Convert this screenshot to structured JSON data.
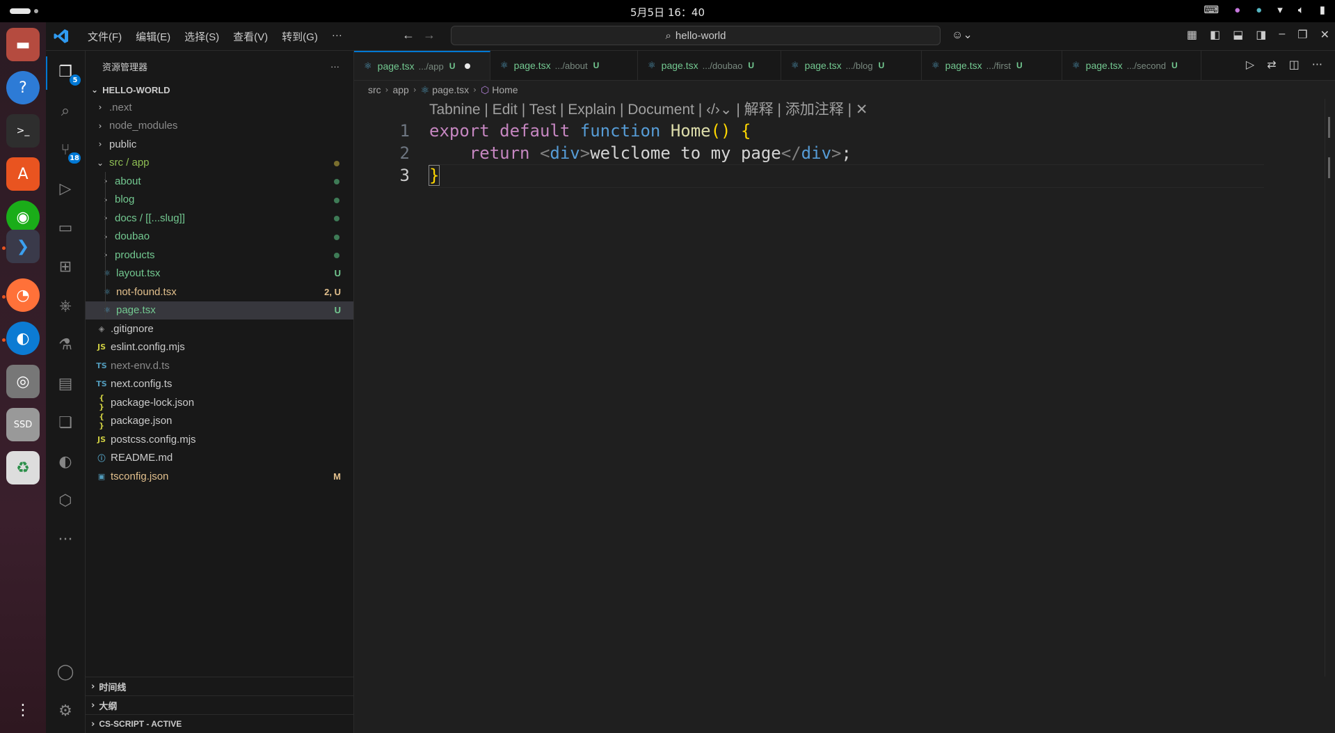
{
  "system": {
    "clock": "5月5日  16：40"
  },
  "titlebar": {
    "menu": [
      "文件(F)",
      "编辑(E)",
      "选择(S)",
      "查看(V)",
      "转到(G)",
      "···"
    ],
    "search_text": "hello-world"
  },
  "activity": {
    "explorer_badge": "5",
    "scm_badge": "18"
  },
  "sidebar": {
    "title": "资源管理器",
    "more": "···",
    "project": "HELLO-WORLD",
    "items": [
      {
        "label": ".next",
        "indent": 1,
        "kind": "folder",
        "color": "#8b8b8b"
      },
      {
        "label": "node_modules",
        "indent": 1,
        "kind": "folder",
        "color": "#8b8b8b"
      },
      {
        "label": "public",
        "indent": 1,
        "kind": "folder",
        "color": "#cccccc"
      },
      {
        "label": "src / app",
        "indent": 1,
        "kind": "folder-open",
        "color": "#8fbf54",
        "dot": "#7a6f2e"
      },
      {
        "label": "about",
        "indent": 2,
        "kind": "folder",
        "color": "#73c991",
        "dot": "#3e7b56"
      },
      {
        "label": "blog",
        "indent": 2,
        "kind": "folder",
        "color": "#73c991",
        "dot": "#3e7b56"
      },
      {
        "label": "docs / [[...slug]]",
        "indent": 2,
        "kind": "folder",
        "color": "#73c991",
        "dot": "#3e7b56"
      },
      {
        "label": "doubao",
        "indent": 2,
        "kind": "folder",
        "color": "#73c991",
        "dot": "#3e7b56"
      },
      {
        "label": "products",
        "indent": 2,
        "kind": "folder",
        "color": "#73c991",
        "dot": "#3e7b56"
      },
      {
        "label": "layout.tsx",
        "indent": 2,
        "kind": "react",
        "color": "#73c991",
        "status": "U",
        "status_color": "#73c991"
      },
      {
        "label": "not-found.tsx",
        "indent": 2,
        "kind": "react",
        "color": "#e2c08d",
        "status": "2, U",
        "status_color": "#e2c08d"
      },
      {
        "label": "page.tsx",
        "indent": 2,
        "kind": "react",
        "color": "#73c991",
        "status": "U",
        "status_color": "#73c991",
        "selected": true
      },
      {
        "label": ".gitignore",
        "indent": 1,
        "kind": "git",
        "color": "#cccccc"
      },
      {
        "label": "eslint.config.mjs",
        "indent": 1,
        "kind": "js",
        "color": "#cccccc"
      },
      {
        "label": "next-env.d.ts",
        "indent": 1,
        "kind": "ts",
        "color": "#8b8b8b"
      },
      {
        "label": "next.config.ts",
        "indent": 1,
        "kind": "ts",
        "color": "#cccccc"
      },
      {
        "label": "package-lock.json",
        "indent": 1,
        "kind": "json",
        "color": "#cccccc"
      },
      {
        "label": "package.json",
        "indent": 1,
        "kind": "json",
        "color": "#cccccc"
      },
      {
        "label": "postcss.config.mjs",
        "indent": 1,
        "kind": "js",
        "color": "#cccccc"
      },
      {
        "label": "README.md",
        "indent": 1,
        "kind": "info",
        "color": "#cccccc"
      },
      {
        "label": "tsconfig.json",
        "indent": 1,
        "kind": "tsjson",
        "color": "#e2c08d",
        "status": "M",
        "status_color": "#e2c08d"
      }
    ],
    "panels": [
      "时间线",
      "大纲",
      "CS-SCRIPT - ACTIVE"
    ]
  },
  "tabs": [
    {
      "name": "page.tsx",
      "path": ".../app",
      "status": "U",
      "active": true,
      "dirty": true
    },
    {
      "name": "page.tsx",
      "path": ".../about",
      "status": "U"
    },
    {
      "name": "page.tsx",
      "path": ".../doubao",
      "status": "U"
    },
    {
      "name": "page.tsx",
      "path": ".../blog",
      "status": "U"
    },
    {
      "name": "page.tsx",
      "path": ".../first",
      "status": "U"
    },
    {
      "name": "page.tsx",
      "path": ".../second",
      "status": "U"
    }
  ],
  "breadcrumb": [
    "src",
    "app",
    "page.tsx",
    "Home"
  ],
  "codelens": "Tabnine | Edit | Test | Explain | Document | ‹/›⌄ | 解释 | 添加注释 | ✕",
  "code": {
    "line_numbers": [
      "1",
      "2",
      "3"
    ],
    "lines": [
      [
        {
          "t": "export",
          "c": "kw2"
        },
        {
          "t": " ",
          "c": "txt"
        },
        {
          "t": "default",
          "c": "kw2"
        },
        {
          "t": " ",
          "c": "txt"
        },
        {
          "t": "function",
          "c": "kw"
        },
        {
          "t": " ",
          "c": "txt"
        },
        {
          "t": "Home",
          "c": "fn"
        },
        {
          "t": "()",
          "c": "br"
        },
        {
          "t": " ",
          "c": "txt"
        },
        {
          "t": "{",
          "c": "br"
        }
      ],
      [
        {
          "t": "    ",
          "c": "txt"
        },
        {
          "t": "return",
          "c": "kw2"
        },
        {
          "t": " ",
          "c": "txt"
        },
        {
          "t": "<",
          "c": "pun"
        },
        {
          "t": "div",
          "c": "tag"
        },
        {
          "t": ">",
          "c": "pun"
        },
        {
          "t": "welclome to my page",
          "c": "txt"
        },
        {
          "t": "</",
          "c": "pun"
        },
        {
          "t": "div",
          "c": "tag"
        },
        {
          "t": ">",
          "c": "pun"
        },
        {
          "t": ";",
          "c": "txt"
        }
      ],
      [
        {
          "t": "}",
          "c": "br"
        }
      ]
    ]
  }
}
